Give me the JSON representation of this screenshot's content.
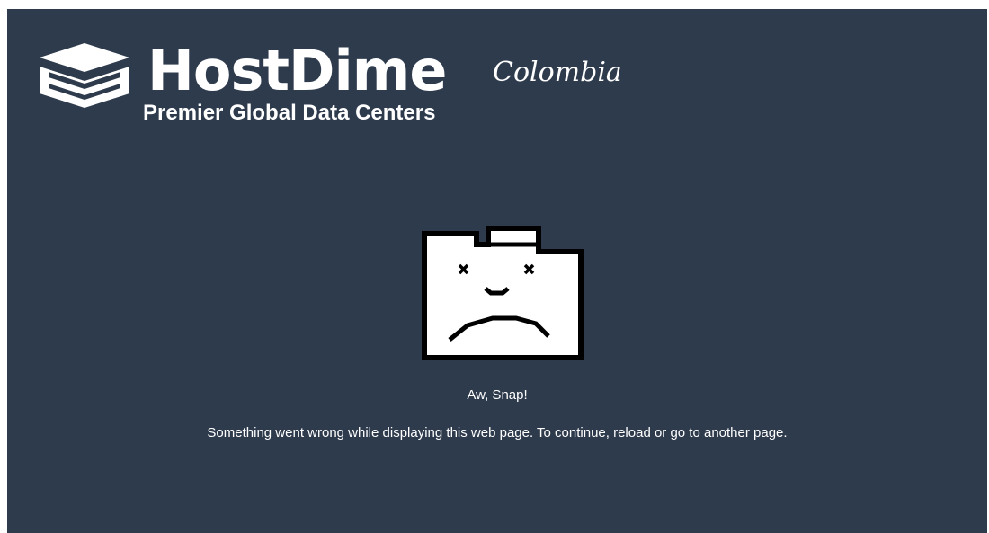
{
  "header": {
    "brand_name": "HostDime",
    "region": "Colombia",
    "tagline": "Premier Global Data Centers",
    "logo_icon": "hostdime-cube-logo"
  },
  "error": {
    "icon": "sad-tab-icon",
    "title": "Aw, Snap!",
    "message": "Something went wrong while displaying this web page. To continue, reload or go to another page."
  },
  "colors": {
    "background": "#2e3b4d",
    "text": "#ffffff",
    "icon_outline": "#000000"
  }
}
